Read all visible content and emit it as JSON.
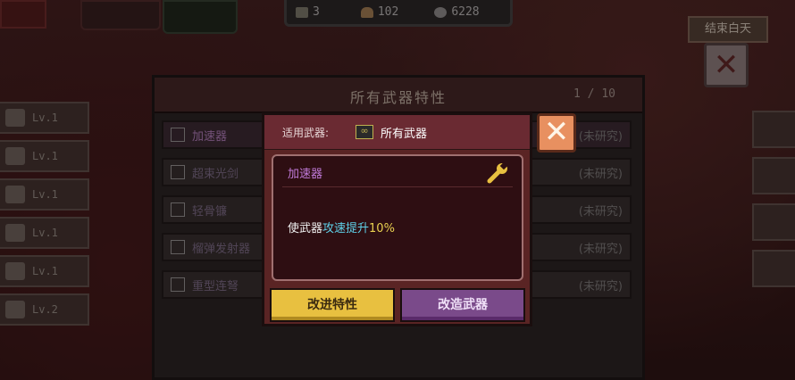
{
  "hud": {
    "days": "3",
    "food": "102",
    "parts": "6228",
    "end_day_label": "结束白天"
  },
  "left_levels": [
    {
      "label": "Lv.1",
      "icon": "home-icon"
    },
    {
      "label": "Lv.1",
      "icon": "radio-icon"
    },
    {
      "label": "Lv.1",
      "icon": "first-aid-icon"
    },
    {
      "label": "Lv.1",
      "icon": "generator-icon"
    },
    {
      "label": "Lv.1",
      "icon": "biohazard-icon"
    },
    {
      "label": "Lv.2",
      "icon": "weapon-bench-icon"
    }
  ],
  "panel": {
    "title": "所有武器特性",
    "page": "1 / 10",
    "rows": [
      {
        "name": "加速器",
        "status": "(未研究)"
      },
      {
        "name": "超束光剑",
        "status": "(未研究)"
      },
      {
        "name": "轻骨镰",
        "status": "(未研究)"
      },
      {
        "name": "榴弹发射器",
        "status": "(未研究)"
      },
      {
        "name": "重型连弩",
        "status": "(未研究)"
      }
    ]
  },
  "dialog": {
    "applicable_label": "适用武器:",
    "applicable_value": "所有武器",
    "trait_name": "加速器",
    "desc_prefix": "使武器",
    "desc_highlight": "攻速提升",
    "desc_number": "10%",
    "btn_improve": "改进特性",
    "btn_modify": "改造武器"
  },
  "colors": {
    "accent_yellow": "#e8c040",
    "accent_purple": "#7a4a8a",
    "trait_name": "#c07ad8",
    "highlight_cyan": "#5fd0e8"
  }
}
